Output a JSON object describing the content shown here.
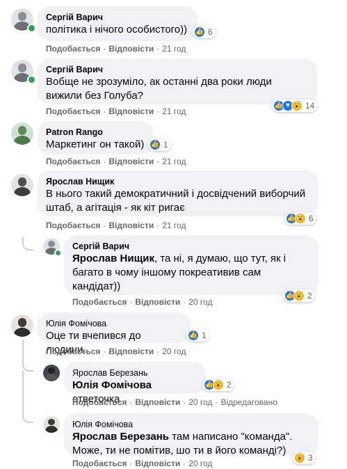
{
  "actions": {
    "like_label": "Подобається",
    "reply_label": "Відповісти",
    "edited_label": "Відредаговано"
  },
  "comments": [
    {
      "author": "Сергій Варич",
      "text": "політика і нічого особистого))",
      "reactions": "6",
      "reaction_types": [
        "like"
      ],
      "time": "21 год"
    },
    {
      "author": "Сергій Варич",
      "text": "Вобще не зрозуміло, ак останні два роки люди вижили без Голуба?",
      "reactions": "14",
      "reaction_types": [
        "like",
        "wow",
        "haha"
      ],
      "time": "21 год"
    },
    {
      "author": "Patron Rango",
      "text": "Маркетинг он такой)",
      "reactions": "1",
      "reaction_types": [
        "like"
      ],
      "time": "21 год"
    },
    {
      "author": "Ярослав Нищик",
      "text": "В нього такий демократичний і досвідчений виборчий штаб, а агітація - як кіт ригає",
      "reactions": "6",
      "reaction_types": [
        "like",
        "wow"
      ],
      "time": "21 год"
    },
    {
      "author": "Сергій Варич",
      "mention": "Ярослав Нищик",
      "text": ", та ні, я думаю, що тут, як і багато в чому іншому покреативив сам кандідат))",
      "reactions": "2",
      "reaction_types": [
        "like",
        "wow"
      ],
      "time": "20 год"
    },
    {
      "author": "Юлія Фомічова",
      "text": "Оце ти вчепився до людини.",
      "reactions": "1",
      "reaction_types": [
        "like"
      ],
      "time": "20 год"
    },
    {
      "author": "Ярослав Березань",
      "mention": "Юлія Фомічова",
      "text": " ответочка",
      "reactions": "2",
      "reaction_types": [
        "like",
        "wow"
      ],
      "time": "20 год",
      "edited": true
    },
    {
      "author": "Юлія Фомічова",
      "mention": "Ярослав Березань",
      "text": " там написано \"команда\". Може, ти не помітив, шо ти в його команді?)",
      "reactions": "3",
      "reaction_types": [
        "wow"
      ],
      "time": "20 год"
    }
  ]
}
